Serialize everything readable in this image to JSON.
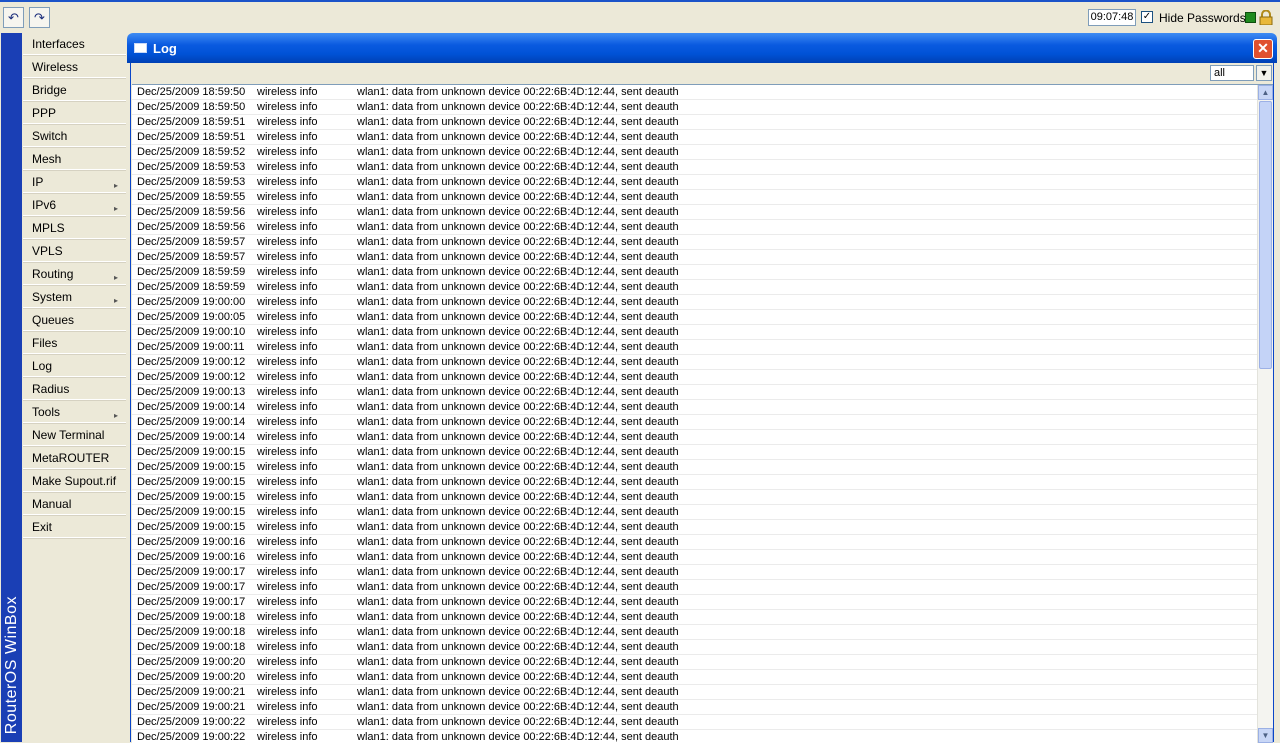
{
  "toolbar": {
    "undo_icon": "undo-icon",
    "redo_icon": "redo-icon",
    "clock": "09:07:48",
    "hide_passwords_label": "Hide Passwords",
    "hide_passwords_checked": "✓",
    "status_color": "#1e8a1e"
  },
  "brand": {
    "text": "RouterOS WinBox"
  },
  "sidebar": {
    "items": [
      {
        "label": "Interfaces"
      },
      {
        "label": "Wireless"
      },
      {
        "label": "Bridge"
      },
      {
        "label": "PPP"
      },
      {
        "label": "Switch"
      },
      {
        "label": "Mesh"
      },
      {
        "label": "IP",
        "arrow": "▸"
      },
      {
        "label": "IPv6",
        "arrow": "▸"
      },
      {
        "label": "MPLS"
      },
      {
        "label": "VPLS"
      },
      {
        "label": "Routing",
        "arrow": "▸"
      },
      {
        "label": "System",
        "arrow": "▸"
      },
      {
        "label": "Queues"
      },
      {
        "label": "Files"
      },
      {
        "label": "Log"
      },
      {
        "label": "Radius"
      },
      {
        "label": "Tools",
        "arrow": "▸"
      },
      {
        "label": "New Terminal"
      },
      {
        "label": "MetaROUTER"
      },
      {
        "label": "Make Supout.rif"
      },
      {
        "label": "Manual"
      },
      {
        "label": "Exit"
      }
    ]
  },
  "window": {
    "title": "Log",
    "close_label": "✕",
    "filter_value": "all",
    "filter_arrow": "▼"
  },
  "log": {
    "rows": [
      {
        "time": "Dec/25/2009 18:59:50",
        "topic": "wireless info",
        "message": "wlan1: data from unknown device 00:22:6B:4D:12:44, sent deauth"
      },
      {
        "time": "Dec/25/2009 18:59:50",
        "topic": "wireless info",
        "message": "wlan1: data from unknown device 00:22:6B:4D:12:44, sent deauth"
      },
      {
        "time": "Dec/25/2009 18:59:51",
        "topic": "wireless info",
        "message": "wlan1: data from unknown device 00:22:6B:4D:12:44, sent deauth"
      },
      {
        "time": "Dec/25/2009 18:59:51",
        "topic": "wireless info",
        "message": "wlan1: data from unknown device 00:22:6B:4D:12:44, sent deauth"
      },
      {
        "time": "Dec/25/2009 18:59:52",
        "topic": "wireless info",
        "message": "wlan1: data from unknown device 00:22:6B:4D:12:44, sent deauth"
      },
      {
        "time": "Dec/25/2009 18:59:53",
        "topic": "wireless info",
        "message": "wlan1: data from unknown device 00:22:6B:4D:12:44, sent deauth"
      },
      {
        "time": "Dec/25/2009 18:59:53",
        "topic": "wireless info",
        "message": "wlan1: data from unknown device 00:22:6B:4D:12:44, sent deauth"
      },
      {
        "time": "Dec/25/2009 18:59:55",
        "topic": "wireless info",
        "message": "wlan1: data from unknown device 00:22:6B:4D:12:44, sent deauth"
      },
      {
        "time": "Dec/25/2009 18:59:56",
        "topic": "wireless info",
        "message": "wlan1: data from unknown device 00:22:6B:4D:12:44, sent deauth"
      },
      {
        "time": "Dec/25/2009 18:59:56",
        "topic": "wireless info",
        "message": "wlan1: data from unknown device 00:22:6B:4D:12:44, sent deauth"
      },
      {
        "time": "Dec/25/2009 18:59:57",
        "topic": "wireless info",
        "message": "wlan1: data from unknown device 00:22:6B:4D:12:44, sent deauth"
      },
      {
        "time": "Dec/25/2009 18:59:57",
        "topic": "wireless info",
        "message": "wlan1: data from unknown device 00:22:6B:4D:12:44, sent deauth"
      },
      {
        "time": "Dec/25/2009 18:59:59",
        "topic": "wireless info",
        "message": "wlan1: data from unknown device 00:22:6B:4D:12:44, sent deauth"
      },
      {
        "time": "Dec/25/2009 18:59:59",
        "topic": "wireless info",
        "message": "wlan1: data from unknown device 00:22:6B:4D:12:44, sent deauth"
      },
      {
        "time": "Dec/25/2009 19:00:00",
        "topic": "wireless info",
        "message": "wlan1: data from unknown device 00:22:6B:4D:12:44, sent deauth"
      },
      {
        "time": "Dec/25/2009 19:00:05",
        "topic": "wireless info",
        "message": "wlan1: data from unknown device 00:22:6B:4D:12:44, sent deauth"
      },
      {
        "time": "Dec/25/2009 19:00:10",
        "topic": "wireless info",
        "message": "wlan1: data from unknown device 00:22:6B:4D:12:44, sent deauth"
      },
      {
        "time": "Dec/25/2009 19:00:11",
        "topic": "wireless info",
        "message": "wlan1: data from unknown device 00:22:6B:4D:12:44, sent deauth"
      },
      {
        "time": "Dec/25/2009 19:00:12",
        "topic": "wireless info",
        "message": "wlan1: data from unknown device 00:22:6B:4D:12:44, sent deauth"
      },
      {
        "time": "Dec/25/2009 19:00:12",
        "topic": "wireless info",
        "message": "wlan1: data from unknown device 00:22:6B:4D:12:44, sent deauth"
      },
      {
        "time": "Dec/25/2009 19:00:13",
        "topic": "wireless info",
        "message": "wlan1: data from unknown device 00:22:6B:4D:12:44, sent deauth"
      },
      {
        "time": "Dec/25/2009 19:00:14",
        "topic": "wireless info",
        "message": "wlan1: data from unknown device 00:22:6B:4D:12:44, sent deauth"
      },
      {
        "time": "Dec/25/2009 19:00:14",
        "topic": "wireless info",
        "message": "wlan1: data from unknown device 00:22:6B:4D:12:44, sent deauth"
      },
      {
        "time": "Dec/25/2009 19:00:14",
        "topic": "wireless info",
        "message": "wlan1: data from unknown device 00:22:6B:4D:12:44, sent deauth"
      },
      {
        "time": "Dec/25/2009 19:00:15",
        "topic": "wireless info",
        "message": "wlan1: data from unknown device 00:22:6B:4D:12:44, sent deauth"
      },
      {
        "time": "Dec/25/2009 19:00:15",
        "topic": "wireless info",
        "message": "wlan1: data from unknown device 00:22:6B:4D:12:44, sent deauth"
      },
      {
        "time": "Dec/25/2009 19:00:15",
        "topic": "wireless info",
        "message": "wlan1: data from unknown device 00:22:6B:4D:12:44, sent deauth"
      },
      {
        "time": "Dec/25/2009 19:00:15",
        "topic": "wireless info",
        "message": "wlan1: data from unknown device 00:22:6B:4D:12:44, sent deauth"
      },
      {
        "time": "Dec/25/2009 19:00:15",
        "topic": "wireless info",
        "message": "wlan1: data from unknown device 00:22:6B:4D:12:44, sent deauth"
      },
      {
        "time": "Dec/25/2009 19:00:15",
        "topic": "wireless info",
        "message": "wlan1: data from unknown device 00:22:6B:4D:12:44, sent deauth"
      },
      {
        "time": "Dec/25/2009 19:00:16",
        "topic": "wireless info",
        "message": "wlan1: data from unknown device 00:22:6B:4D:12:44, sent deauth"
      },
      {
        "time": "Dec/25/2009 19:00:16",
        "topic": "wireless info",
        "message": "wlan1: data from unknown device 00:22:6B:4D:12:44, sent deauth"
      },
      {
        "time": "Dec/25/2009 19:00:17",
        "topic": "wireless info",
        "message": "wlan1: data from unknown device 00:22:6B:4D:12:44, sent deauth"
      },
      {
        "time": "Dec/25/2009 19:00:17",
        "topic": "wireless info",
        "message": "wlan1: data from unknown device 00:22:6B:4D:12:44, sent deauth"
      },
      {
        "time": "Dec/25/2009 19:00:17",
        "topic": "wireless info",
        "message": "wlan1: data from unknown device 00:22:6B:4D:12:44, sent deauth"
      },
      {
        "time": "Dec/25/2009 19:00:18",
        "topic": "wireless info",
        "message": "wlan1: data from unknown device 00:22:6B:4D:12:44, sent deauth"
      },
      {
        "time": "Dec/25/2009 19:00:18",
        "topic": "wireless info",
        "message": "wlan1: data from unknown device 00:22:6B:4D:12:44, sent deauth"
      },
      {
        "time": "Dec/25/2009 19:00:18",
        "topic": "wireless info",
        "message": "wlan1: data from unknown device 00:22:6B:4D:12:44, sent deauth"
      },
      {
        "time": "Dec/25/2009 19:00:20",
        "topic": "wireless info",
        "message": "wlan1: data from unknown device 00:22:6B:4D:12:44, sent deauth"
      },
      {
        "time": "Dec/25/2009 19:00:20",
        "topic": "wireless info",
        "message": "wlan1: data from unknown device 00:22:6B:4D:12:44, sent deauth"
      },
      {
        "time": "Dec/25/2009 19:00:21",
        "topic": "wireless info",
        "message": "wlan1: data from unknown device 00:22:6B:4D:12:44, sent deauth"
      },
      {
        "time": "Dec/25/2009 19:00:21",
        "topic": "wireless info",
        "message": "wlan1: data from unknown device 00:22:6B:4D:12:44, sent deauth"
      },
      {
        "time": "Dec/25/2009 19:00:22",
        "topic": "wireless info",
        "message": "wlan1: data from unknown device 00:22:6B:4D:12:44, sent deauth"
      },
      {
        "time": "Dec/25/2009 19:00:22",
        "topic": "wireless info",
        "message": "wlan1: data from unknown device 00:22:6B:4D:12:44, sent deauth"
      }
    ]
  },
  "scroll": {
    "up_glyph": "▲",
    "down_glyph": "▼"
  }
}
